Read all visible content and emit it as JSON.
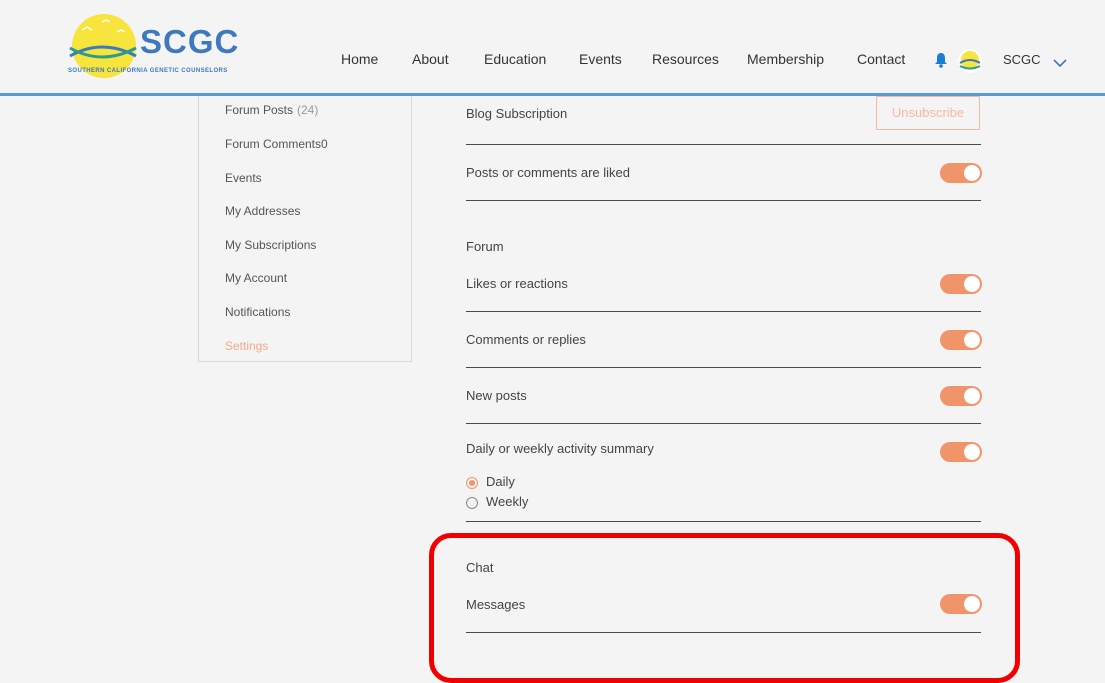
{
  "header": {
    "logo_text": "SCGC",
    "logo_subtext": "SOUTHERN CALIFORNIA GENETIC COUNSELORS",
    "nav": [
      "Home",
      "About",
      "Education",
      "Events",
      "Resources",
      "Membership",
      "Contact"
    ],
    "user_name": "SCGC"
  },
  "sidebar": {
    "items": [
      {
        "label": "Forum Posts",
        "count": "(24)"
      },
      {
        "label": "Forum Comments0"
      },
      {
        "label": "Events"
      },
      {
        "label": "My Addresses"
      },
      {
        "label": "My Subscriptions"
      },
      {
        "label": "My Account"
      },
      {
        "label": "Notifications"
      },
      {
        "label": "Settings"
      }
    ]
  },
  "settings": {
    "blog_subscription_label": "Blog Subscription",
    "unsubscribe_label": "Unsubscribe",
    "posts_liked_label": "Posts or comments are liked",
    "forum_title": "Forum",
    "likes_label": "Likes or reactions",
    "comments_label": "Comments or replies",
    "new_posts_label": "New posts",
    "summary_label": "Daily or weekly activity summary",
    "summary_options": [
      "Daily",
      "Weekly"
    ],
    "summary_selected": "Daily",
    "chat_title": "Chat",
    "messages_label": "Messages",
    "toggles_on": true
  },
  "colors": {
    "accent": "#f0956a",
    "nav_line": "#5b9bd5",
    "highlight": "#f00000"
  }
}
